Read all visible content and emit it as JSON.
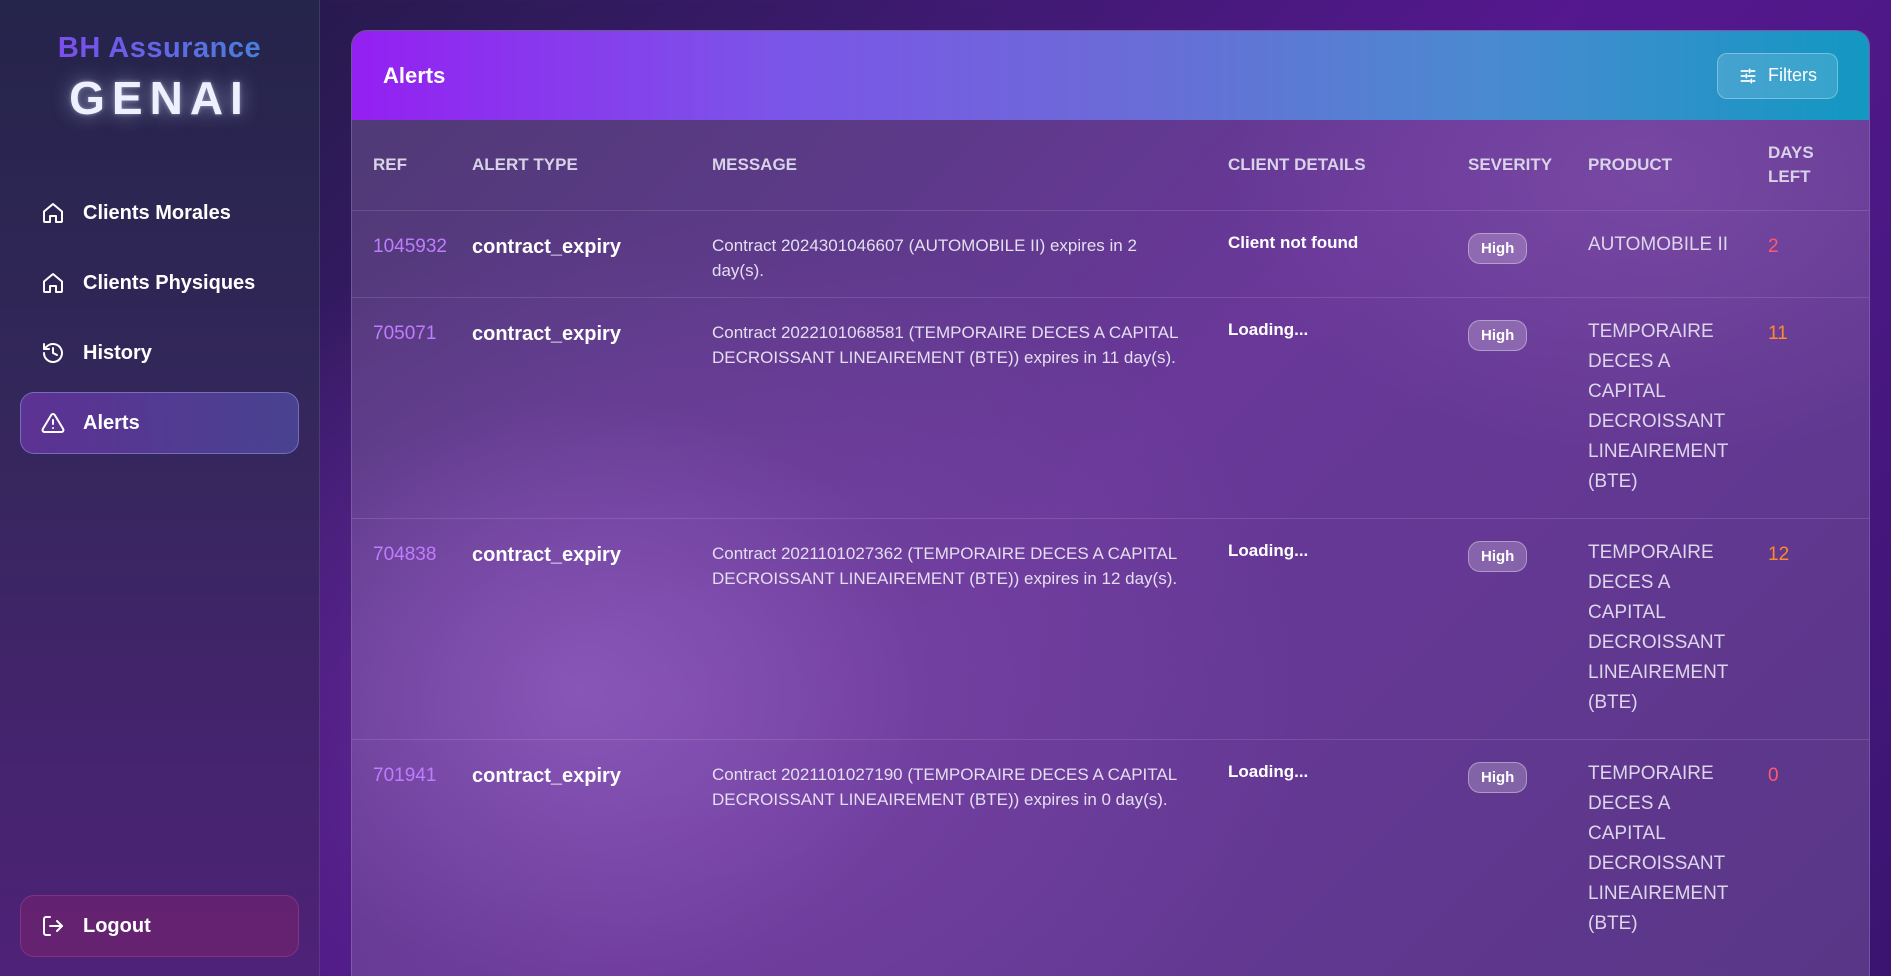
{
  "brand": {
    "top": "BH Assurance",
    "main": "GENAI"
  },
  "sidebar": {
    "items": [
      {
        "label": "Clients Morales",
        "icon": "home-icon"
      },
      {
        "label": "Clients Physiques",
        "icon": "home-icon"
      },
      {
        "label": "History",
        "icon": "history-icon"
      },
      {
        "label": "Alerts",
        "icon": "alert-triangle-icon",
        "active": true
      }
    ],
    "logout_label": "Logout"
  },
  "panel": {
    "title": "Alerts",
    "filters_label": "Filters"
  },
  "table": {
    "headers": {
      "ref": "REF",
      "alert_type": "ALERT TYPE",
      "message": "MESSAGE",
      "client_details": "CLIENT DETAILS",
      "severity": "SEVERITY",
      "product": "PRODUCT",
      "days_left": "DAYS LEFT"
    },
    "rows": [
      {
        "ref": "1045932",
        "alert_type": "contract_expiry",
        "message": "Contract 2024301046607 (AUTOMOBILE II) expires in 2 day(s).",
        "client": "Client not found",
        "severity": "High",
        "product": "AUTOMOBILE II",
        "days_left": "2",
        "days_color": "#ff5a6e"
      },
      {
        "ref": "705071",
        "alert_type": "contract_expiry",
        "message": "Contract 2022101068581 (TEMPORAIRE DECES A CAPITAL DECROISSANT LINEAIREMENT (BTE)) expires in 11 day(s).",
        "client": "Loading...",
        "severity": "High",
        "product": "TEMPORAIRE DECES A CAPITAL DECROISSANT LINEAIREMENT (BTE)",
        "days_left": "11",
        "days_color": "#ff8a2a"
      },
      {
        "ref": "704838",
        "alert_type": "contract_expiry",
        "message": "Contract 2021101027362 (TEMPORAIRE DECES A CAPITAL DECROISSANT LINEAIREMENT (BTE)) expires in 12 day(s).",
        "client": "Loading...",
        "severity": "High",
        "product": "TEMPORAIRE DECES A CAPITAL DECROISSANT LINEAIREMENT (BTE)",
        "days_left": "12",
        "days_color": "#ff8a2a"
      },
      {
        "ref": "701941",
        "alert_type": "contract_expiry",
        "message": "Contract 2021101027190 (TEMPORAIRE DECES A CAPITAL DECROISSANT LINEAIREMENT (BTE)) expires in 0 day(s).",
        "client": "Loading...",
        "severity": "High",
        "product": "TEMPORAIRE DECES A CAPITAL DECROISSANT LINEAIREMENT (BTE)",
        "days_left": "0",
        "days_color": "#ff5a6e"
      }
    ]
  }
}
